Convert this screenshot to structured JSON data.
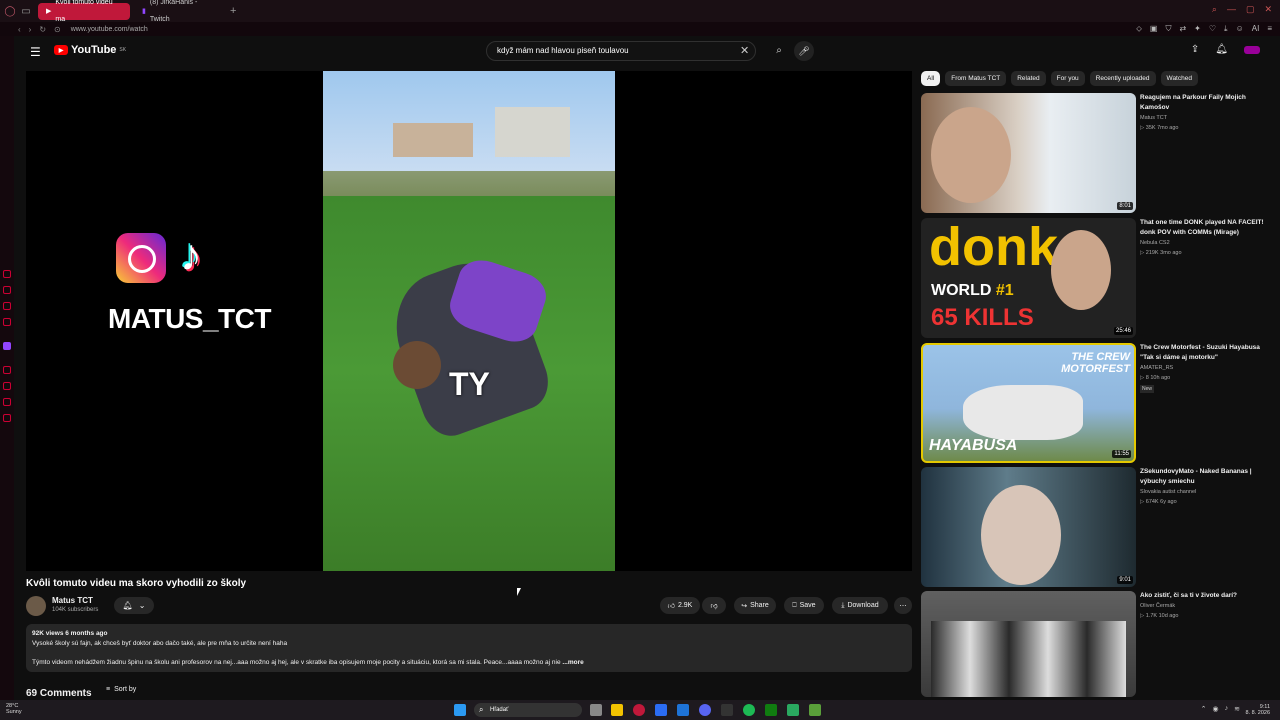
{
  "browser": {
    "tabs": [
      {
        "label": "Kvôli tomuto videu ma"
      },
      {
        "label": "(8) JirkaHanis - Twitch"
      }
    ],
    "new_tab": "+",
    "url": "www.youtube.com/watch",
    "extensions_label": "AI"
  },
  "header": {
    "logo_text": "YouTube",
    "logo_country": "SK",
    "search_value": "když mám nad hlavou piseň toulavou"
  },
  "video": {
    "overlay_name": "MATUS_TCT",
    "overlay_caption": "TY",
    "title": "Kvôli tomuto videu ma skoro vyhodili zo školy",
    "channel": "Matus TCT",
    "subscribers": "104K subscribers",
    "likes": "2.9K",
    "share_label": "Share",
    "save_label": "Save",
    "download_label": "Download"
  },
  "description": {
    "meta": "92K views  6 months ago",
    "line1": "Vysoké školy sú fajn, ak chceš byť doktor abo dačo také, ale pre mňa to určite není haha",
    "line2": "Týmto videom nehádžem žiadnu špinu na školu ani profesorov na nej...aaa možno aj hej, ale v skratke iba opisujem moje pocity a situáciu, ktorá sa mi stala. Peace...aaaa možno aj nie",
    "more": "...more"
  },
  "comments": {
    "count": "69 Comments",
    "sort_label": "Sort by"
  },
  "chips": [
    "All",
    "From Matus TCT",
    "Related",
    "For you",
    "Recently uploaded",
    "Watched"
  ],
  "recommendations": [
    {
      "title": "Reagujem na Parkour Faily Mojich Kamošov",
      "channel": "Matus TCT",
      "meta": "▷ 35K  7mo ago",
      "duration": "8:01",
      "badge": ""
    },
    {
      "title": "That one time DONK played NA FACEIT! donk POV with COMMs (Mirage)",
      "channel": "Nebula CS2",
      "meta": "▷ 219K  3mo ago",
      "duration": "25:46",
      "badge": ""
    },
    {
      "title": "The Crew Motorfest - Suzuki Hayabusa \"Tak si dáme aj motorku\"",
      "channel": "AMATER_RS",
      "meta": "▷ 8  10h ago",
      "duration": "11:55",
      "badge": "New"
    },
    {
      "title": "ZSekundovyMato - Naked Bananas | výbuchy smiechu",
      "channel": "Slovakia autist channel",
      "meta": "▷ 674K  6y ago",
      "duration": "9:01",
      "badge": ""
    },
    {
      "title": "Ako zistiť, či sa ti v živote darí?",
      "channel": "Oliver Čermák",
      "meta": "▷ 1.7K  10d ago",
      "duration": "",
      "badge": ""
    }
  ],
  "thumb_text": {
    "donk": "donk",
    "world": "WORLD",
    "rank": "#1",
    "kills_num": "65",
    "kills": "KILLS",
    "crew": "THE CREW MOTORFEST",
    "hayabusa": "HAYABUSA"
  },
  "taskbar": {
    "weather_temp": "28°C",
    "weather_desc": "Sunny",
    "search": "Hľadať",
    "time": "9:11",
    "date": "8. 8. 2026"
  },
  "colors": {
    "accent": "#ff0000",
    "browser_accent": "#c0183a",
    "bg": "#0f0f0f"
  }
}
